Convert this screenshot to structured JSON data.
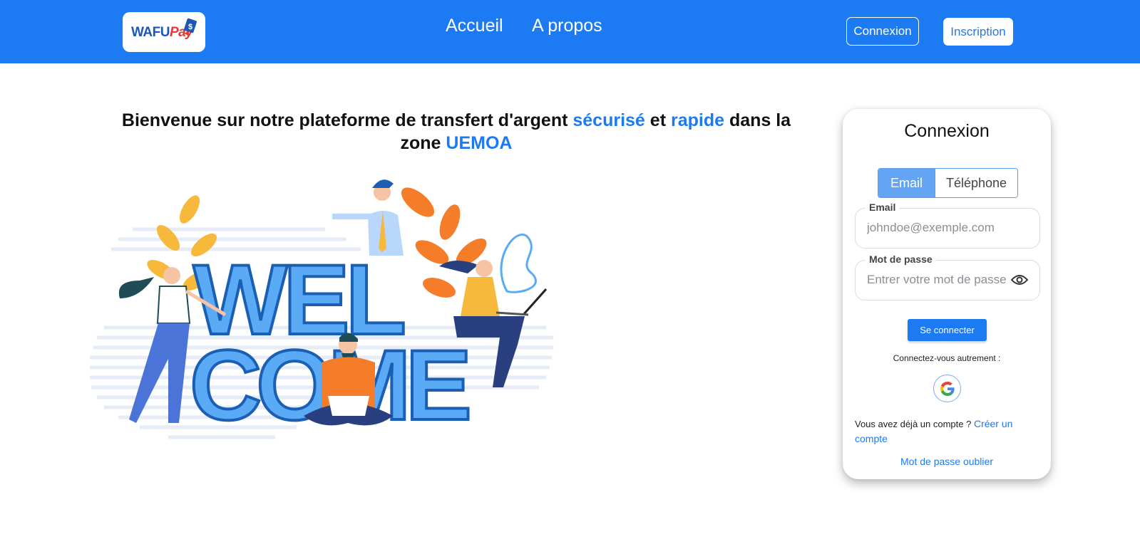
{
  "header": {
    "logo": {
      "text_main": "WAFU",
      "text_accent": "Pay"
    },
    "nav": [
      {
        "label": "Accueil"
      },
      {
        "label": "A propos"
      }
    ],
    "login_button": "Connexion",
    "signup_button": "Inscription"
  },
  "headline": {
    "part1": "Bienvenue sur notre plateforme de transfert d'argent ",
    "highlight1": "sécurisé",
    "part2": " et ",
    "highlight2": "rapide",
    "part3": " dans la zone ",
    "highlight3": "UEMOA"
  },
  "illustration": {
    "line1": "WEL",
    "line2": "COME"
  },
  "login_card": {
    "title": "Connexion",
    "tabs": [
      {
        "label": "Email",
        "active": true
      },
      {
        "label": "Téléphone",
        "active": false
      }
    ],
    "email_label": "Email",
    "email_placeholder": "johndoe@exemple.com",
    "password_label": "Mot de passe",
    "password_placeholder": "Entrer votre mot de passe",
    "submit_label": "Se connecter",
    "alt_login_text": "Connectez-vous autrement :",
    "account_question": "Vous avez déjà un compte ? ",
    "create_account_link": "Créer un compte",
    "forgot_password": "Mot de passe oublier"
  },
  "colors": {
    "primary": "#1c7af2",
    "tab_active": "#63a4f3",
    "illustration_blue": "#5aaaf5",
    "illustration_dark_blue": "#1a5fb4",
    "illustration_orange": "#f57c28",
    "illustration_yellow": "#f6b93b"
  },
  "icons": {
    "logo_mark": "dollar-tag-icon",
    "password_toggle": "eye-icon",
    "social_login": "google-icon"
  }
}
